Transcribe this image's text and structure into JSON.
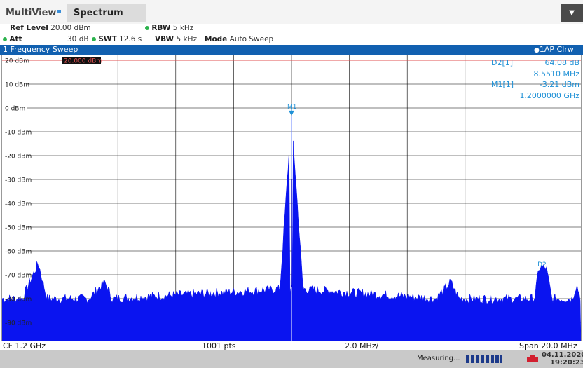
{
  "tabs": {
    "multiview": "MultiView",
    "spectrum": "Spectrum"
  },
  "menu": {
    "dropdown_glyph": "▼"
  },
  "settings": {
    "ref_level_label": "Ref Level",
    "ref_level_value": "20.00 dBm",
    "rbw_label": "RBW",
    "rbw_value": "5 kHz",
    "att_label": "Att",
    "att_value": "30 dB",
    "swt_label": "SWT",
    "swt_value": "12.6 s",
    "vbw_label": "VBW",
    "vbw_value": "5 kHz",
    "mode_label": "Mode",
    "mode_value": "Auto Sweep"
  },
  "window": {
    "title": "1 Frequency Sweep",
    "trace_label": "1AP Clrw"
  },
  "plot": {
    "y_ticks": [
      "20 dBm",
      "10 dBm",
      "0 dBm",
      "-10 dBm",
      "-20 dBm",
      "-30 dBm",
      "-40 dBm",
      "-50 dBm",
      "-60 dBm",
      "-70 dBm",
      "-80 dBm",
      "-90 dBm"
    ],
    "ref_line_label": "20.000 dBm",
    "marker_m1": "M1",
    "marker_d2": "D2",
    "marker_table": [
      {
        "name": "D2[1]",
        "value": "64.08 dB"
      },
      {
        "name": "",
        "value": "8.5510 MHz"
      },
      {
        "name": "M1[1]",
        "value": "-3.21 dBm"
      },
      {
        "name": "",
        "value": "1.2000000 GHz"
      }
    ],
    "colors": {
      "trace": "#0a14f0",
      "marker": "#1e90d6",
      "refline": "#e05050",
      "grid": "#000000"
    }
  },
  "chart_data": {
    "type": "line",
    "ylim": [
      -100,
      20
    ],
    "xlim_mhz": [
      1190,
      1210
    ],
    "grid": true,
    "series": [
      {
        "values_dbm": [
          {
            "x": 1190.0,
            "y": -80
          },
          {
            "x": 1190.7,
            "y": -80
          },
          {
            "x": 1191.25,
            "y": -65
          },
          {
            "x": 1191.55,
            "y": -80
          },
          {
            "x": 1193.0,
            "y": -80
          },
          {
            "x": 1193.55,
            "y": -73
          },
          {
            "x": 1193.8,
            "y": -80
          },
          {
            "x": 1199.6,
            "y": -76
          },
          {
            "x": 1200.0,
            "y": -3.21
          },
          {
            "x": 1200.4,
            "y": -76
          },
          {
            "x": 1205.0,
            "y": -80
          },
          {
            "x": 1205.5,
            "y": -73
          },
          {
            "x": 1205.8,
            "y": -80
          },
          {
            "x": 1208.4,
            "y": -80
          },
          {
            "x": 1208.55,
            "y": -67
          },
          {
            "x": 1208.8,
            "y": -67
          },
          {
            "x": 1209.0,
            "y": -80
          },
          {
            "x": 1209.7,
            "y": -80
          },
          {
            "x": 1209.85,
            "y": -74
          },
          {
            "x": 1210.0,
            "y": -80
          }
        ]
      }
    ]
  },
  "footer": {
    "cf": "CF 1.2 GHz",
    "pts": "1001 pts",
    "div": "2.0 MHz/",
    "span": "Span 20.0 MHz"
  },
  "status": {
    "measuring": "Measuring...",
    "date": "04.11.2020",
    "time": "19:20:23"
  }
}
